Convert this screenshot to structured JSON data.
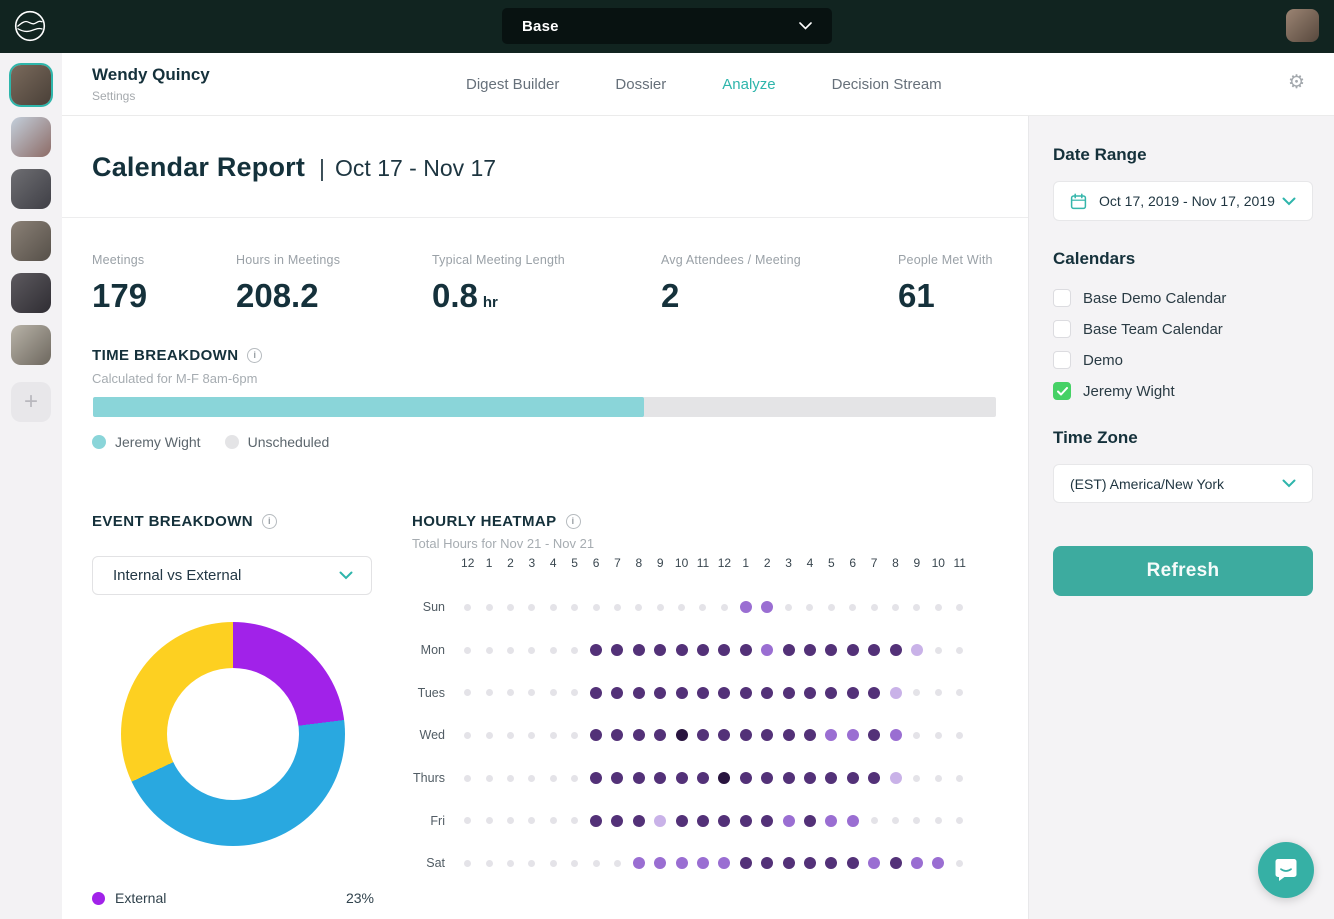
{
  "topbar": {
    "workspace": "Base"
  },
  "header": {
    "user_name": "Wendy Quincy",
    "user_settings": "Settings",
    "nav": [
      {
        "label": "Digest Builder",
        "active": false
      },
      {
        "label": "Dossier",
        "active": false
      },
      {
        "label": "Analyze",
        "active": true
      },
      {
        "label": "Decision Stream",
        "active": false
      }
    ],
    "active_color": "#2eb5ab"
  },
  "rail": {
    "avatars": [
      {
        "selected": true,
        "colors": [
          "#7a6a5c",
          "#4a4038"
        ]
      },
      {
        "selected": false,
        "colors": [
          "#c3cfdb",
          "#8d6b66"
        ]
      },
      {
        "selected": false,
        "colors": [
          "#6e6e72",
          "#3f3f46"
        ]
      },
      {
        "selected": false,
        "colors": [
          "#8a8076",
          "#565049"
        ]
      },
      {
        "selected": false,
        "colors": [
          "#5d5a5f",
          "#2f2d33"
        ]
      },
      {
        "selected": false,
        "colors": [
          "#b8b3a8",
          "#6d675e"
        ]
      }
    ],
    "add_glyph": "+"
  },
  "report": {
    "title": "Calendar Report",
    "separator": "|",
    "date_range": "Oct 17 - Nov 17"
  },
  "stats": [
    {
      "label": "Meetings",
      "value": "179",
      "unit": ""
    },
    {
      "label": "Hours in Meetings",
      "value": "208.2",
      "unit": ""
    },
    {
      "label": "Typical Meeting Length",
      "value": "0.8",
      "unit": "hr"
    },
    {
      "label": "Avg Attendees / Meeting",
      "value": "2",
      "unit": ""
    },
    {
      "label": "People Met With",
      "value": "61",
      "unit": ""
    }
  ],
  "time_breakdown": {
    "heading": "TIME BREAKDOWN",
    "subtitle": "Calculated for M-F 8am-6pm"
  },
  "event_breakdown": {
    "heading": "EVENT BREAKDOWN",
    "dropdown_value": "Internal vs External"
  },
  "hourly_heatmap": {
    "heading": "HOURLY HEATMAP",
    "subtitle": "Total Hours for Nov 21 - Nov 21"
  },
  "chart_data": {
    "time_utilization_bar": {
      "type": "bar",
      "title": "TIME BREAKDOWN",
      "subtitle": "Calculated for M-F 8am-6pm",
      "series": [
        {
          "name": "Jeremy Wight",
          "pct": 61,
          "color": "#8ad5d9"
        },
        {
          "name": "Unscheduled",
          "pct": 39,
          "color": "#e4e4e6"
        }
      ],
      "legend_position": "bottom-left"
    },
    "event_breakdown_donut": {
      "type": "pie",
      "title": "EVENT BREAKDOWN",
      "control": "Internal vs External",
      "start": "top-clockwise",
      "segments": [
        {
          "label": "External",
          "pct": 23,
          "color": "#a122e9"
        },
        {
          "label": "",
          "pct": 45,
          "color": "#29a8e0"
        },
        {
          "label": "",
          "pct": 32,
          "color": "#fdd021"
        }
      ],
      "legend_visible": [
        {
          "label": "External",
          "color": "#a122e9",
          "value": "23%"
        }
      ]
    },
    "hourly_heatmap": {
      "type": "heatmap",
      "title": "HOURLY HEATMAP",
      "subtitle": "Total Hours for Nov 21 - Nov 21",
      "hours": [
        "12",
        "1",
        "2",
        "3",
        "4",
        "5",
        "6",
        "7",
        "8",
        "9",
        "10",
        "11",
        "12",
        "1",
        "2",
        "3",
        "4",
        "5",
        "6",
        "7",
        "8",
        "9",
        "10",
        "11"
      ],
      "level_colors": [
        "#e4e3e8",
        "#c9b2e8",
        "#9a6ed2",
        "#533178",
        "#29143f"
      ],
      "rows": [
        {
          "label": "Sun",
          "values": [
            0,
            0,
            0,
            0,
            0,
            0,
            0,
            0,
            0,
            0,
            0,
            0,
            0,
            2,
            2,
            0,
            0,
            0,
            0,
            0,
            0,
            0,
            0,
            0
          ]
        },
        {
          "label": "Mon",
          "values": [
            0,
            0,
            0,
            0,
            0,
            0,
            3,
            3,
            3,
            3,
            3,
            3,
            3,
            3,
            2,
            3,
            3,
            3,
            3,
            3,
            3,
            1,
            0,
            0
          ]
        },
        {
          "label": "Tues",
          "values": [
            0,
            0,
            0,
            0,
            0,
            0,
            3,
            3,
            3,
            3,
            3,
            3,
            3,
            3,
            3,
            3,
            3,
            3,
            3,
            3,
            1,
            0,
            0,
            0
          ]
        },
        {
          "label": "Wed",
          "values": [
            0,
            0,
            0,
            0,
            0,
            0,
            3,
            3,
            3,
            3,
            4,
            3,
            3,
            3,
            3,
            3,
            3,
            2,
            2,
            3,
            2,
            0,
            0,
            0
          ]
        },
        {
          "label": "Thurs",
          "values": [
            0,
            0,
            0,
            0,
            0,
            0,
            3,
            3,
            3,
            3,
            3,
            3,
            4,
            3,
            3,
            3,
            3,
            3,
            3,
            3,
            1,
            0,
            0,
            0
          ]
        },
        {
          "label": "Fri",
          "values": [
            0,
            0,
            0,
            0,
            0,
            0,
            3,
            3,
            3,
            1,
            3,
            3,
            3,
            3,
            3,
            2,
            3,
            2,
            2,
            0,
            0,
            0,
            0,
            0
          ]
        },
        {
          "label": "Sat",
          "values": [
            0,
            0,
            0,
            0,
            0,
            0,
            0,
            0,
            2,
            2,
            2,
            2,
            2,
            3,
            3,
            3,
            3,
            3,
            3,
            2,
            3,
            2,
            2,
            0
          ]
        }
      ]
    }
  },
  "sidebar": {
    "date_range_heading": "Date Range",
    "date_range_value": "Oct 17, 2019 - Nov 17, 2019",
    "calendars_heading": "Calendars",
    "calendars": [
      {
        "label": "Base Demo Calendar",
        "checked": false
      },
      {
        "label": "Base Team Calendar",
        "checked": false
      },
      {
        "label": "Demo",
        "checked": false
      },
      {
        "label": "Jeremy Wight",
        "checked": true
      }
    ],
    "checked_color": "#45d165",
    "timezone_heading": "Time Zone",
    "timezone_value": "(EST) America/New York",
    "refresh_label": "Refresh"
  },
  "icons": {
    "info_glyph": "i",
    "gear_glyph": "⚙"
  }
}
